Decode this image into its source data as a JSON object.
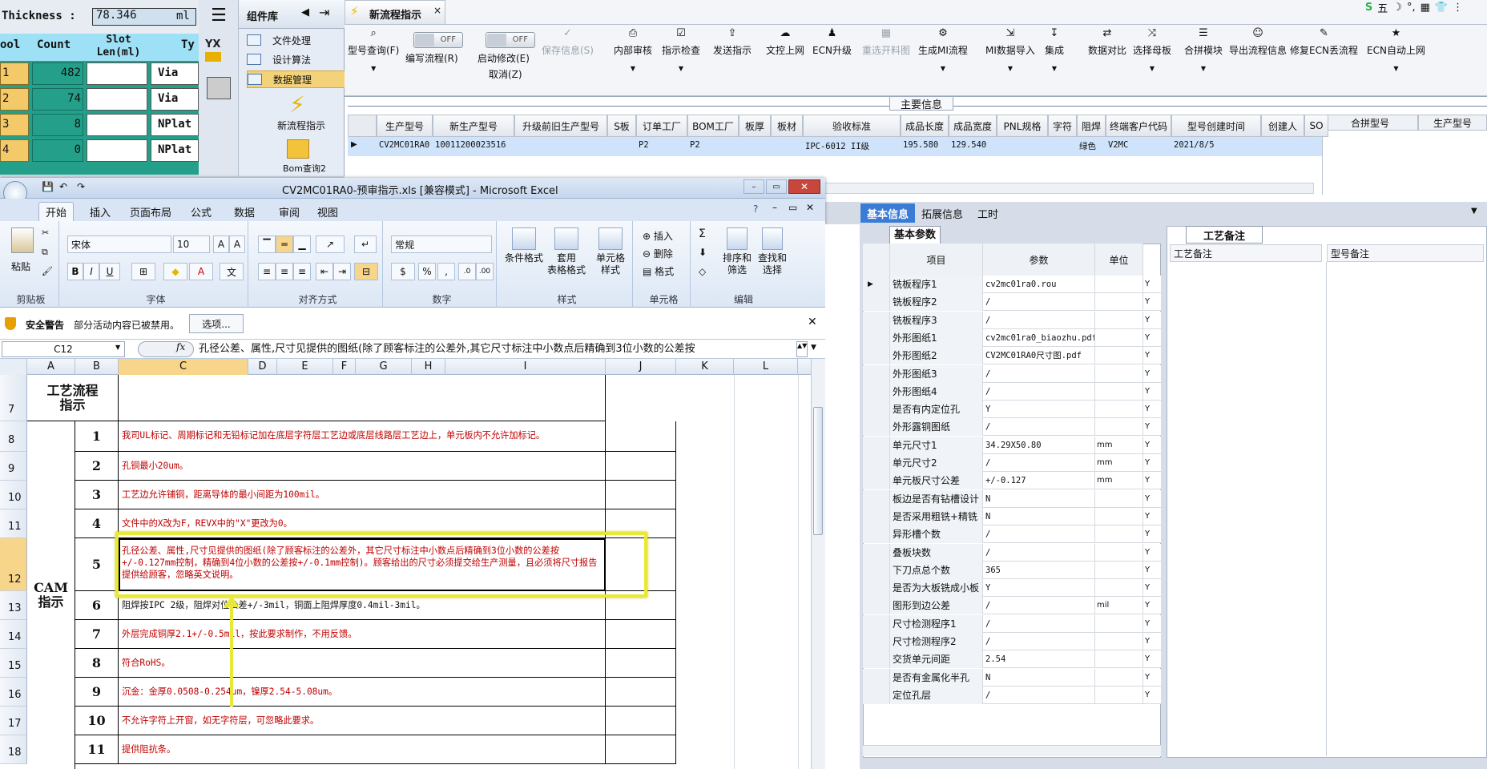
{
  "left_grid": {
    "thickness_label": "Thickness :",
    "thickness_value": "78.346",
    "thickness_unit": "ml",
    "headers": [
      "ool",
      "Count",
      "Slot Len(ml)",
      "Ty"
    ],
    "rows": [
      {
        "id": "1",
        "count": "482",
        "type": "Via"
      },
      {
        "id": "2",
        "count": "74",
        "type": "Via"
      },
      {
        "id": "3",
        "count": "8",
        "type": "NPlat"
      },
      {
        "id": "4",
        "count": "0",
        "type": "NPlat"
      }
    ]
  },
  "component_panel": {
    "title": "组件库",
    "items": [
      "文件处理",
      "设计算法",
      "数据管理"
    ],
    "big_items": [
      "新流程指示",
      "Bom查询2"
    ],
    "yx_label": "YX"
  },
  "main_window": {
    "tab_title": "新流程指示",
    "buttons": [
      {
        "label": "型号查询(F)",
        "sub": ""
      },
      {
        "label": "编写流程(R)",
        "sub": "OFF"
      },
      {
        "label": "启动修改(E)",
        "sub": "OFF"
      },
      {
        "label": "取消(Z)",
        "sub": ""
      },
      {
        "label": "保存信息(S)",
        "sub": ""
      },
      {
        "label": "内部审核",
        "sub": ""
      },
      {
        "label": "指示检查",
        "sub": ""
      },
      {
        "label": "发送指示",
        "sub": ""
      },
      {
        "label": "文控上网",
        "sub": ""
      },
      {
        "label": "ECN升级",
        "sub": ""
      },
      {
        "label": "重选开料图",
        "sub": ""
      },
      {
        "label": "生成MI流程",
        "sub": ""
      },
      {
        "label": "MI数据导入",
        "sub": ""
      },
      {
        "label": "集成",
        "sub": ""
      },
      {
        "label": "数据对比",
        "sub": ""
      },
      {
        "label": "选择母板",
        "sub": ""
      },
      {
        "label": "合拼模块",
        "sub": ""
      },
      {
        "label": "导出流程信息",
        "sub": ""
      },
      {
        "label": "修复ECN丢流程",
        "sub": ""
      },
      {
        "label": "ECN自动上网",
        "sub": ""
      }
    ],
    "section_title": "主要信息",
    "grid_headers": [
      "生产型号",
      "新生产型号",
      "升级前旧生产型号",
      "S板",
      "订单工厂",
      "BOM工厂",
      "板厚",
      "板材",
      "验收标准",
      "成品长度",
      "成品宽度",
      "PNL规格",
      "字符",
      "阻焊",
      "终端客户代码",
      "型号创建时间",
      "创建人",
      "SO"
    ],
    "grid_row": [
      "CV2MC01RA0",
      "10011200023516",
      "",
      "",
      "P2",
      "P2",
      "",
      "",
      "IPC-6012 II级",
      "195.580",
      "129.540",
      "",
      "",
      "绿色",
      "V2MC",
      "2021/8/5",
      "",
      ""
    ],
    "right_headers": [
      "合拼型号",
      "生产型号"
    ]
  },
  "params_panel": {
    "tabs": [
      "基本信息",
      "拓展信息",
      "工时"
    ],
    "sub_tab": "基本参数",
    "col_headers": [
      "项目",
      "参数",
      "单位"
    ],
    "rows": [
      {
        "name": "铣板程序1",
        "value": "cv2mc01ra0.rou",
        "unit": "",
        "flag": "Y"
      },
      {
        "name": "铣板程序2",
        "value": "/",
        "unit": "",
        "flag": "Y"
      },
      {
        "name": "铣板程序3",
        "value": "/",
        "unit": "",
        "flag": "Y"
      },
      {
        "name": "外形图纸1",
        "value": "cv2mc01ra0_biaozhu.pdf",
        "unit": "",
        "flag": "Y"
      },
      {
        "name": "外形图纸2",
        "value": "CV2MC01RA0尺寸图.pdf",
        "unit": "",
        "flag": "Y"
      },
      {
        "name": "外形图纸3",
        "value": "/",
        "unit": "",
        "flag": "Y"
      },
      {
        "name": "外形图纸4",
        "value": "/",
        "unit": "",
        "flag": "Y"
      },
      {
        "name": "是否有内定位孔",
        "value": "Y",
        "unit": "",
        "flag": "Y"
      },
      {
        "name": "外形露铜图纸",
        "value": "/",
        "unit": "",
        "flag": "Y"
      },
      {
        "name": "单元尺寸1",
        "value": "34.29X50.80",
        "unit": "mm",
        "flag": "Y"
      },
      {
        "name": "单元尺寸2",
        "value": "/",
        "unit": "mm",
        "flag": "Y"
      },
      {
        "name": "单元板尺寸公差",
        "value": "+/-0.127",
        "unit": "mm",
        "flag": "Y"
      },
      {
        "name": "板边是否有钻槽设计",
        "value": "N",
        "unit": "",
        "flag": "Y"
      },
      {
        "name": "是否采用粗铣+精铣",
        "value": "N",
        "unit": "",
        "flag": "Y"
      },
      {
        "name": "异形槽个数",
        "value": "/",
        "unit": "",
        "flag": "Y"
      },
      {
        "name": "叠板块数",
        "value": "/",
        "unit": "",
        "flag": "Y"
      },
      {
        "name": "下刀点总个数",
        "value": "365",
        "unit": "",
        "flag": "Y"
      },
      {
        "name": "是否为大板铣成小板",
        "value": "Y",
        "unit": "",
        "flag": "Y"
      },
      {
        "name": "图形到边公差",
        "value": "/",
        "unit": "mil",
        "flag": "Y"
      },
      {
        "name": "尺寸检测程序1",
        "value": "/",
        "unit": "",
        "flag": "Y"
      },
      {
        "name": "尺寸检测程序2",
        "value": "/",
        "unit": "",
        "flag": "Y"
      },
      {
        "name": "交货单元间距",
        "value": "2.54",
        "unit": "",
        "flag": "Y"
      },
      {
        "name": "是否有金属化半孔",
        "value": "N",
        "unit": "",
        "flag": "Y"
      },
      {
        "name": "定位孔层",
        "value": "/",
        "unit": "",
        "flag": "Y"
      }
    ],
    "notes_tab": "工艺备注",
    "notes_headers": [
      "工艺备注",
      "型号备注"
    ]
  },
  "excel": {
    "title": "CV2MC01RA0-预审指示.xls  [兼容模式] - Microsoft Excel",
    "tabs": [
      "开始",
      "插入",
      "页面布局",
      "公式",
      "数据",
      "审阅",
      "视图"
    ],
    "font_name": "宋体",
    "font_size": "10",
    "number_format": "常规",
    "groups": [
      "剪贴板",
      "字体",
      "对齐方式",
      "数字",
      "样式",
      "单元格",
      "编辑"
    ],
    "paste": "粘贴",
    "style_buttons": [
      "条件格式",
      "套用\n表格格式",
      "单元格\n样式"
    ],
    "cell_buttons": [
      "插入",
      "删除",
      "格式"
    ],
    "edit_buttons": [
      "排序和\n筛选",
      "查找和\n选择"
    ],
    "security_title": "安全警告",
    "security_text": "部分活动内容已被禁用。",
    "options_button": "选项...",
    "name_box": "C12",
    "formula": "孔径公差、属性,尺寸见提供的图纸(除了顾客标注的公差外,其它尺寸标注中小数点后精确到3位小数的公差按",
    "columns": [
      "A",
      "B",
      "C",
      "D",
      "E",
      "F",
      "G",
      "H",
      "I",
      "J",
      "K",
      "L"
    ],
    "row7_header": "工艺流程\n指示",
    "cam_label": "CAM\n指示",
    "rows": [
      {
        "row": "7",
        "no": "",
        "text": ""
      },
      {
        "row": "8",
        "no": "1",
        "text": "我司UL标记、周期标记和无铅标记加在底层字符层工艺边或底层线路层工艺边上，单元板内不允许加标记。"
      },
      {
        "row": "9",
        "no": "2",
        "text": "孔铜最小20um。"
      },
      {
        "row": "10",
        "no": "3",
        "text": "工艺边允许铺铜，距离导体的最小间距为100mil。"
      },
      {
        "row": "11",
        "no": "4",
        "text": "文件中的X改为F，REVX中的\"X\"更改为0。"
      },
      {
        "row": "12",
        "no": "5",
        "text": "孔径公差、属性,尺寸见提供的图纸(除了顾客标注的公差外，其它尺寸标注中小数点后精确到3位小数的公差按+/-0.127mm控制，精确到4位小数的公差按+/-0.1mm控制)。顾客给出的尺寸必须提交给生产测量，且必须将尺寸报告提供给顾客，忽略英文说明。"
      },
      {
        "row": "13",
        "no": "6",
        "text": "阻焊按IPC 2级，阻焊对位公差+/-3mil，铜面上阻焊厚度0.4mil-3mil。"
      },
      {
        "row": "14",
        "no": "7",
        "text": "外层完成铜厚2.1+/-0.5mil，按此要求制作，不用反馈。"
      },
      {
        "row": "15",
        "no": "8",
        "text": "符合RoHS。"
      },
      {
        "row": "16",
        "no": "9",
        "text": "沉金：金厚0.0508-0.254um，镍厚2.54-5.08um。"
      },
      {
        "row": "17",
        "no": "10",
        "text": "不允许字符上开窗，如无字符层，可忽略此要求。"
      },
      {
        "row": "18",
        "no": "11",
        "text": "提供阻抗条。"
      }
    ]
  },
  "colors": {
    "grid_green": "#24a08a",
    "highlight_yellow": "#e8e83a",
    "red_text": "#c00000",
    "selected_row": "#cfe3fb"
  }
}
